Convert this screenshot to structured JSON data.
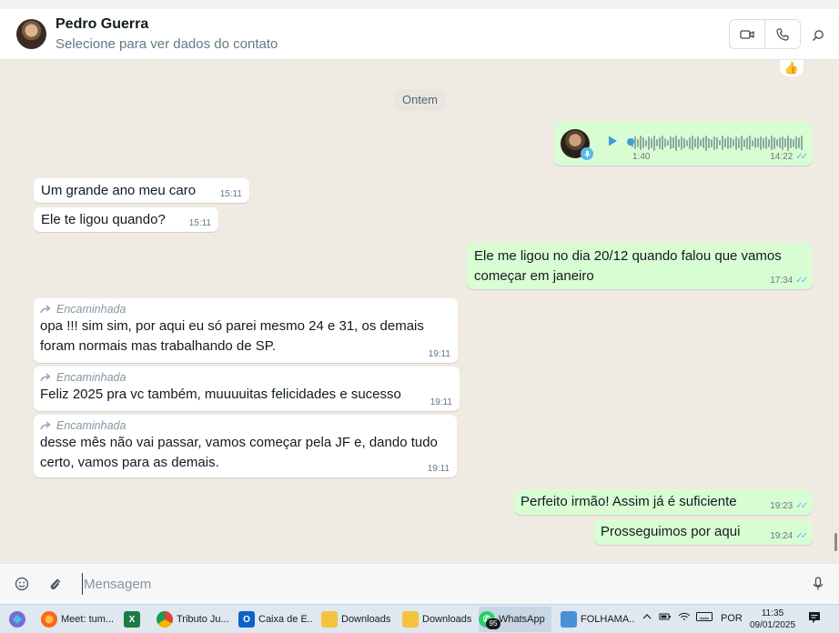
{
  "header": {
    "contact_name": "Pedro Guerra",
    "contact_subtitle": "Selecione para ver dados do contato"
  },
  "chat": {
    "date_chip": "Ontem",
    "reaction": "👍",
    "voice_note": {
      "duration": "1:40",
      "time": "14:22",
      "status": "read"
    },
    "messages": [
      {
        "dir": "in",
        "text": "Um grande ano meu caro",
        "time": "15:11"
      },
      {
        "dir": "in",
        "text": "Ele te ligou quando?",
        "time": "15:11"
      },
      {
        "dir": "out",
        "text": "Ele me ligou no dia 20/12 quando falou que vamos começar em janeiro",
        "time": "17:34"
      },
      {
        "dir": "in",
        "forwarded": "Encaminhada",
        "text": "opa !!!  sim sim, por aqui eu só parei mesmo 24 e 31, os demais foram  normais mas trabalhando de SP.",
        "time": "19:11"
      },
      {
        "dir": "in",
        "forwarded": "Encaminhada",
        "text": "Feliz 2025 pra vc também, muuuuitas felicidades e sucesso",
        "time": "19:11"
      },
      {
        "dir": "in",
        "forwarded": "Encaminhada",
        "text": "desse mês não vai passar, vamos começar pela JF e, dando tudo certo, vamos para as demais.",
        "time": "19:11"
      },
      {
        "dir": "out",
        "text": "Perfeito irmão! Assim já é suficiente",
        "time": "19:23"
      },
      {
        "dir": "out",
        "text": "Prosseguimos por aqui",
        "time": "19:24"
      }
    ]
  },
  "composer": {
    "placeholder": "Mensagem"
  },
  "taskbar": {
    "items": [
      {
        "label": "Meet: tum..."
      },
      {
        "label": "Tributo Ju..."
      },
      {
        "label": "Caixa de E..."
      },
      {
        "label": "Downloads"
      },
      {
        "label": "Downloads"
      },
      {
        "label": "WhatsApp",
        "badge": "95"
      },
      {
        "label": "FOLHAMA..."
      }
    ],
    "language": "POR",
    "time": "11:35",
    "date": "09/01/2025"
  },
  "colors": {
    "incoming_bubble": "#ffffff",
    "outgoing_bubble": "#d9fdd3",
    "chat_background": "#efeae2",
    "read_ticks": "#53bdeb"
  }
}
